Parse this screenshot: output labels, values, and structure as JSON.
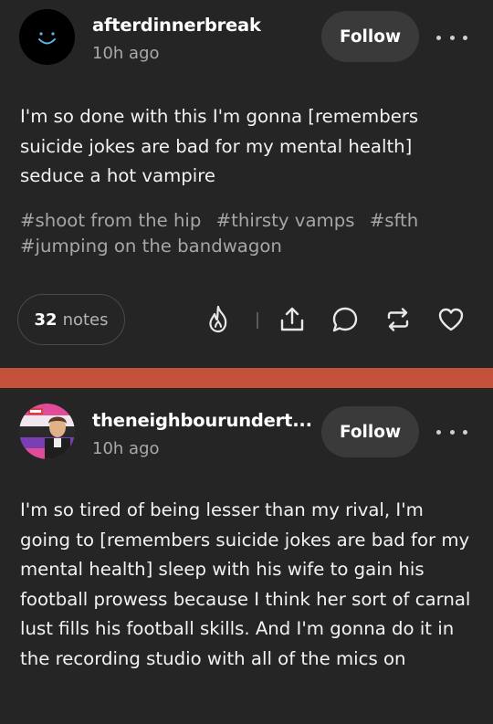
{
  "posts": [
    {
      "username": "afterdinnerbreak",
      "time": "10h ago",
      "follow_label": "Follow",
      "avatar_icon": "smiley-face-icon",
      "body": "I'm so done with this I'm gonna [remembers suicide jokes are bad for my mental health] seduce a hot vampire",
      "tags": [
        "#shoot from the hip",
        "#thirsty vamps",
        "#sfth",
        "#jumping on the bandwagon"
      ],
      "notes_count": "32",
      "notes_label": "notes",
      "actions": [
        "flame-icon",
        "share-icon",
        "reply-icon",
        "reblog-icon",
        "heart-icon"
      ]
    },
    {
      "username": "theneighbourundert...",
      "time": "10h ago",
      "follow_label": "Follow",
      "avatar_icon": "pride-flag-portrait-avatar",
      "body": "I'm so tired of being lesser than my rival, I'm going to [remembers suicide jokes are bad for my mental health] sleep with his wife to gain his football prowess because I think her sort of carnal lust fills his football skills. And I'm gonna do it in the recording studio with all of the mics on"
    }
  ],
  "colors": {
    "background": "#252525",
    "divider": "#c4513c",
    "button": "#3a3a3a",
    "muted_text": "#a6a6a6",
    "smiley": "#5bb8e8"
  }
}
